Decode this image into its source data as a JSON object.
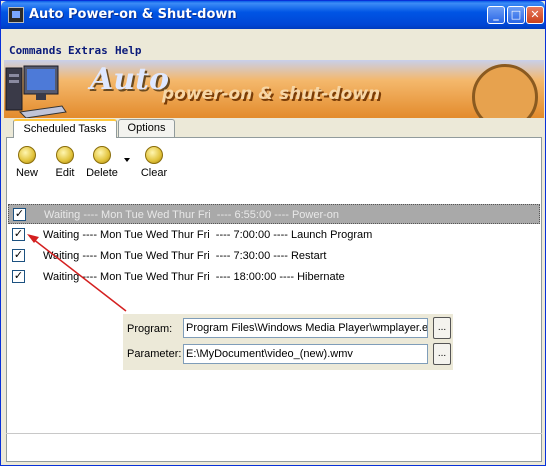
{
  "window": {
    "title": "Auto Power-on & Shut-down"
  },
  "titlebar_buttons": {
    "minimize": "_",
    "maximize": "□",
    "close": "✕"
  },
  "menu": [
    "Commands",
    "Extras",
    "Help"
  ],
  "banner": {
    "title_word1": "Auto",
    "title_word2": "power-on & shut-down"
  },
  "tabs": [
    {
      "label": "Scheduled Tasks",
      "active": true
    },
    {
      "label": "Options",
      "active": false
    }
  ],
  "toolbar": {
    "new_label": "New",
    "edit_label": "Edit",
    "delete_label": "Delete",
    "clear_label": "Clear"
  },
  "tasks": [
    {
      "checked": true,
      "text": "Waiting ---- Mon Tue Wed Thur Fri  ---- 6:55:00 ---- Power-on",
      "selected": true
    },
    {
      "checked": true,
      "text": "Waiting ---- Mon Tue Wed Thur Fri  ---- 7:00:00 ---- Launch Program",
      "selected": false
    },
    {
      "checked": true,
      "text": "Waiting ---- Mon Tue Wed Thur Fri  ---- 7:30:00 ---- Restart",
      "selected": false
    },
    {
      "checked": true,
      "text": "Waiting ---- Mon Tue Wed Thur Fri  ---- 18:00:00 ---- Hibernate",
      "selected": false
    }
  ],
  "popup": {
    "program_label": "Program:",
    "program_value": "Program Files\\Windows Media Player\\wmplayer.exe",
    "parameter_label": "Parameter:",
    "parameter_value": "E:\\MyDocument\\video_(new).wmv",
    "browse_label": "..."
  },
  "colors": {
    "titlebar": "#0055e5",
    "annotation_arrow": "#d42020",
    "selected_row": "#a9a9a9"
  }
}
